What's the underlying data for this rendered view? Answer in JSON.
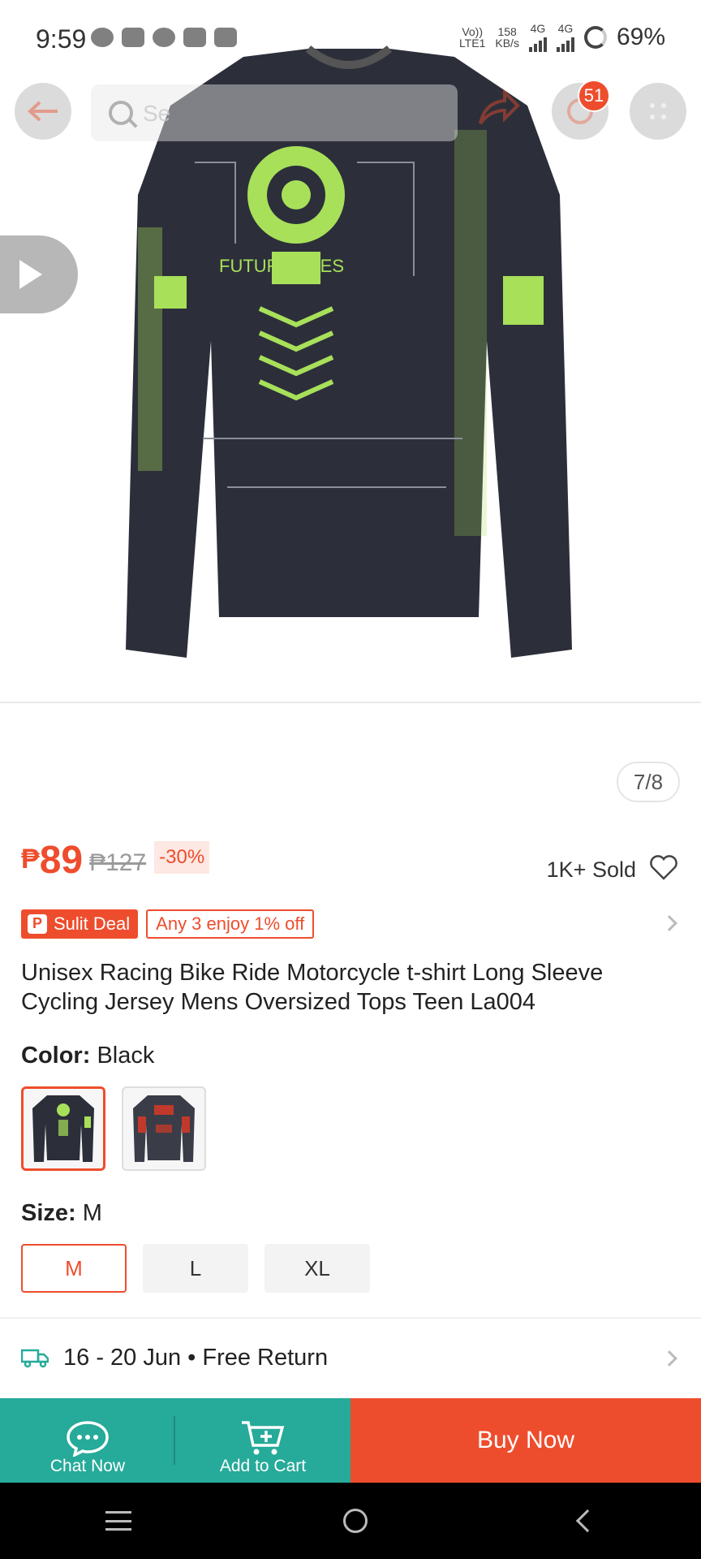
{
  "status_bar": {
    "time": "9:59",
    "network_speed_value": "158",
    "network_speed_unit": "KB/s",
    "volte_top": "Vo))",
    "volte_bottom": "LTE1",
    "sim1_type": "4G",
    "sim2_type": "4G",
    "battery": "69%"
  },
  "header": {
    "search_placeholder": "Se",
    "cart_count": "51"
  },
  "gallery": {
    "counter": "7/8",
    "graphic_text": "FUTURE EYES"
  },
  "price": {
    "currency": "₱",
    "current": "89",
    "original": "₱127",
    "discount": "-30%",
    "sold": "1K+ Sold"
  },
  "deals": {
    "badge": "Sulit Deal",
    "promo": "Any 3 enjoy 1% off"
  },
  "product": {
    "title": "Unisex Racing Bike Ride Motorcycle t-shirt Long Sleeve Cycling Jersey Mens Oversized Tops Teen La004"
  },
  "color": {
    "label": "Color:",
    "selected": "Black"
  },
  "size": {
    "label": "Size:",
    "selected": "M",
    "options": [
      "M",
      "L",
      "XL"
    ]
  },
  "shipping": {
    "text": "16 - 20 Jun • Free Return"
  },
  "actions": {
    "chat": "Chat Now",
    "add_to_cart": "Add to Cart",
    "buy_now": "Buy Now"
  },
  "colors": {
    "accent": "#ee4d2d",
    "teal": "#26aa99"
  }
}
